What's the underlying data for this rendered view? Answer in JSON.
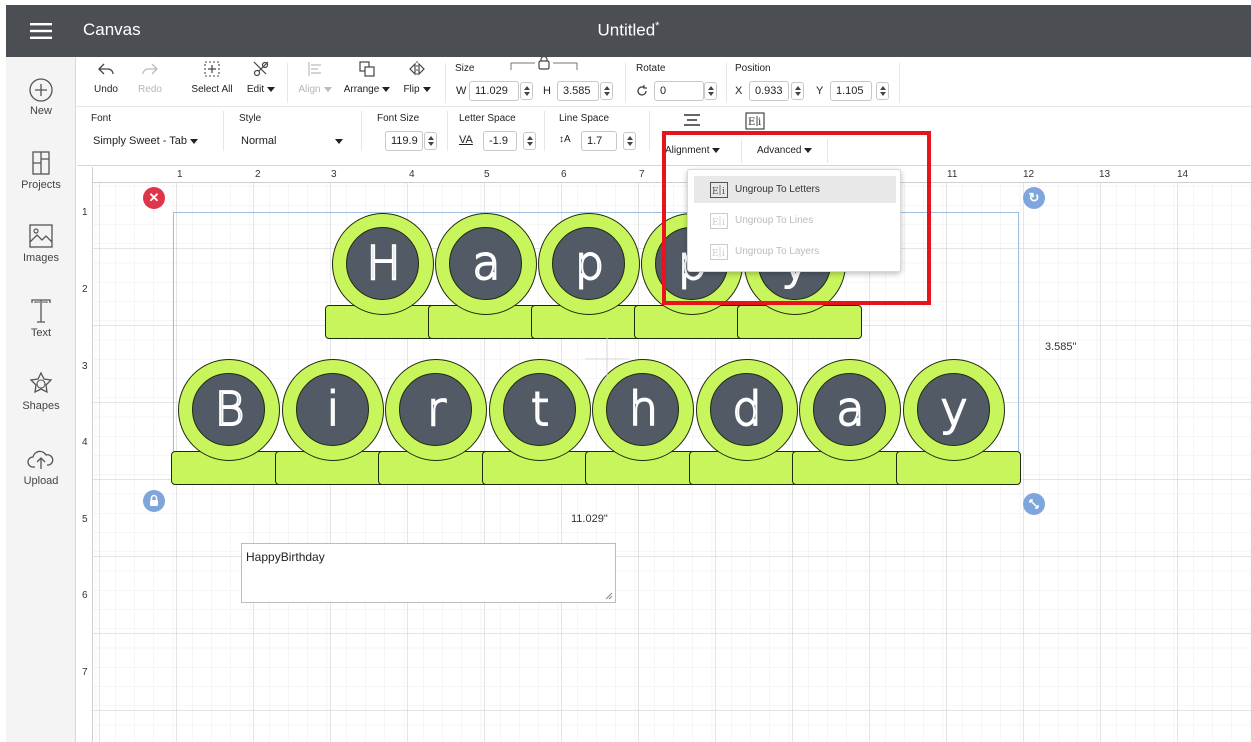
{
  "header": {
    "menu_icon": "hamburger-menu-icon",
    "app_title": "Canvas",
    "doc_title": "Untitled",
    "unsaved_mark": "*"
  },
  "sidebar": {
    "items": [
      {
        "label": "New",
        "icon": "plus-circle-icon"
      },
      {
        "label": "Projects",
        "icon": "projects-icon"
      },
      {
        "label": "Images",
        "icon": "image-icon"
      },
      {
        "label": "Text",
        "icon": "text-icon"
      },
      {
        "label": "Shapes",
        "icon": "shapes-icon"
      },
      {
        "label": "Upload",
        "icon": "upload-cloud-icon"
      }
    ]
  },
  "toolbar": {
    "undo": "Undo",
    "redo": "Redo",
    "select_all": "Select All",
    "edit": "Edit",
    "align": "Align",
    "arrange": "Arrange",
    "flip": "Flip",
    "size_label": "Size",
    "w_label": "W",
    "w_value": "11.029",
    "h_label": "H",
    "h_value": "3.585",
    "rotate_label": "Rotate",
    "rotate_value": "0",
    "position_label": "Position",
    "x_label": "X",
    "x_value": "0.933",
    "y_label": "Y",
    "y_value": "1.105"
  },
  "text_toolbar": {
    "font_label": "Font",
    "font_value": "Simply Sweet - Tab",
    "style_label": "Style",
    "style_value": "Normal",
    "font_size_label": "Font Size",
    "font_size_value": "119.9",
    "letter_space_label": "Letter Space",
    "letter_space_icon_text": "VA",
    "letter_space_value": "-1.9",
    "line_space_label": "Line Space",
    "line_space_icon_text": "↕A",
    "line_space_value": "1.7",
    "alignment": "Alignment",
    "advanced": "Advanced"
  },
  "advanced_menu": {
    "items": [
      {
        "label": "Ungroup To Letters",
        "enabled": true
      },
      {
        "label": "Ungroup To Lines",
        "enabled": false
      },
      {
        "label": "Ungroup To Layers",
        "enabled": false
      }
    ]
  },
  "rulers": {
    "top": [
      "1",
      "2",
      "3",
      "4",
      "5",
      "6",
      "7",
      "11",
      "12",
      "13",
      "14"
    ],
    "left": [
      "1",
      "2",
      "3",
      "4",
      "5",
      "6",
      "7"
    ]
  },
  "canvas": {
    "line1": [
      "H",
      "a",
      "p",
      "p",
      "y"
    ],
    "line2": [
      "B",
      "i",
      "r",
      "t",
      "h",
      "d",
      "a",
      "y"
    ],
    "width_label": "11.029\"",
    "height_label": "3.585\"",
    "text_box_value": "HappyBirthday"
  },
  "colors": {
    "header_bg": "#4b4f54",
    "tab_green": "#c9f55c",
    "tab_inner": "#525a66",
    "highlight_red": "#e8141c",
    "handle_red": "#e0344a",
    "handle_blue": "#7ea6dc"
  }
}
